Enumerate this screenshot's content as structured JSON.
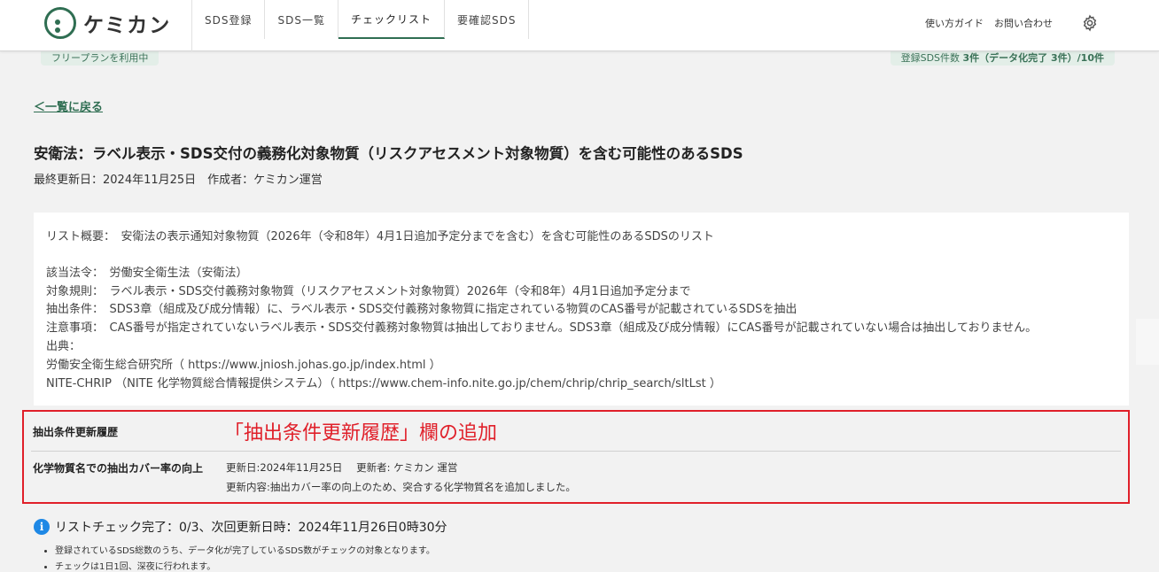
{
  "header": {
    "logo_text": "ケミカン",
    "nav": [
      {
        "label": "SDS登録"
      },
      {
        "label": "SDS一覧"
      },
      {
        "label": "チェックリスト"
      },
      {
        "label": "要確認SDS"
      }
    ],
    "guide_link": "使い方ガイド",
    "contact_link": "お問い合わせ"
  },
  "banner": {
    "plan": "フリープランを利用中",
    "count_prefix": "登録SDS件数",
    "count_value": "3件（データ化完了 3件）/10件"
  },
  "back_link": "＜一覧に戻る",
  "title": "安衛法：ラベル表示・SDS交付の義務化対象物質（リスクアセスメント対象物質）を含む可能性のあるSDS",
  "meta": "最終更新日：2024年11月25日　作成者：ケミカン運営",
  "info": {
    "summary": "リスト概要：　安衛法の表示通知対象物質（2026年（令和8年）4月1日追加予定分までを含む）を含む可能性のあるSDSのリスト",
    "law": "該当法令：　労働安全衛生法（安衛法）",
    "regulation": "対象規則：　ラベル表示・SDS交付義務対象物質（リスクアセスメント対象物質）2026年（令和8年）4月1日追加予定分まで",
    "condition": "抽出条件：　SDS3章（組成及び成分情報）に、ラベル表示・SDS交付義務対象物質に指定されている物質のCAS番号が記載されているSDSを抽出",
    "note": "注意事項：　CAS番号が指定されていないラベル表示・SDS交付義務対象物質は抽出しておりません。SDS3章（組成及び成分情報）にCAS番号が記載されていない場合は抽出しておりません。",
    "source_label": "出典：",
    "source1": "労働安全衛生総合研究所（ https://www.jniosh.johas.go.jp/index.html ）",
    "source2": "NITE-CHRIP （NITE 化学物質総合情報提供システム）（ https://www.chem-info.nite.go.jp/chem/chrip/chrip_search/sltLst ）"
  },
  "history": {
    "heading": "抽出条件更新履歴",
    "annotation": "「抽出条件更新履歴」欄の追加",
    "item_title": "化学物質名での抽出カバー率の向上",
    "updated_date": "更新日:2024年11月25日",
    "updated_by": "更新者: ケミカン 運営",
    "content": "更新内容:抽出カバー率の向上のため、突合する化学物質名を追加しました。"
  },
  "status": {
    "text": "リストチェック完了：0/3、次回更新日時：2024年11月26日0時30分"
  },
  "notes": [
    "登録されているSDS総数のうち、データ化が完了しているSDS数がチェックの対象となります。",
    "チェックは1日1回、深夜に行われます。"
  ],
  "colors": {
    "brand_green": "#2f6e52",
    "annotation_red": "#e0202a",
    "info_blue": "#1e88e5"
  }
}
